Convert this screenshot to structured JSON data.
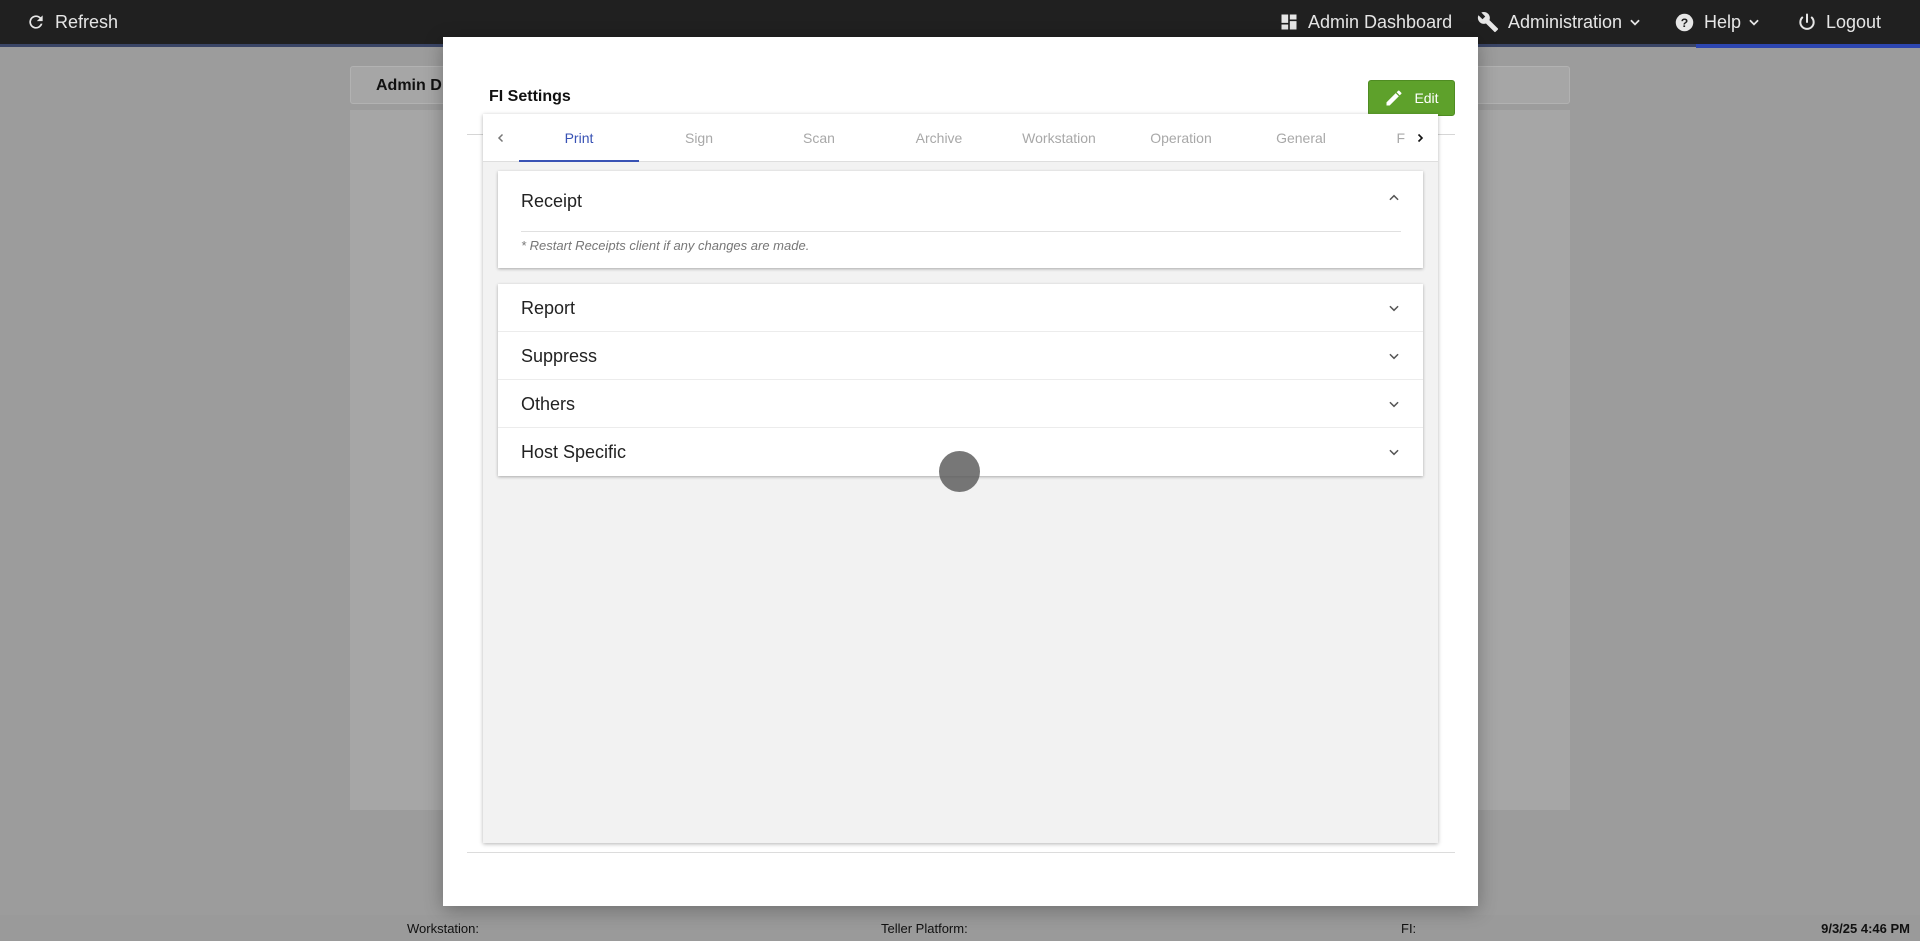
{
  "topbar": {
    "refresh_label": "Refresh",
    "admin_dashboard_label": "Admin Dashboard",
    "administration_label": "Administration",
    "help_label": "Help",
    "logout_label": "Logout"
  },
  "background": {
    "tab_label": "Admin D"
  },
  "status_bar": {
    "workstation_label": "Workstation:",
    "teller_platform_label": "Teller Platform:",
    "fi_label": "FI:",
    "datetime": "9/3/25 4:46 PM"
  },
  "modal": {
    "title": "FI Settings",
    "edit_label": "Edit",
    "tabs": [
      {
        "label": "Print",
        "active": true
      },
      {
        "label": "Sign",
        "active": false
      },
      {
        "label": "Scan",
        "active": false
      },
      {
        "label": "Archive",
        "active": false
      },
      {
        "label": "Workstation",
        "active": false
      },
      {
        "label": "Operation",
        "active": false
      },
      {
        "label": "General",
        "active": false
      },
      {
        "label": "F",
        "active": false
      }
    ],
    "expanded_panel": {
      "title": "Receipt",
      "note": "* Restart Receipts client if any changes are made."
    },
    "collapsed_panels": [
      {
        "title": "Report"
      },
      {
        "title": "Suppress"
      },
      {
        "title": "Others"
      },
      {
        "title": "Host Specific"
      }
    ]
  },
  "colors": {
    "topbar_bg": "#202020",
    "accent_blue": "#3852b4",
    "edit_green": "#5ea12b",
    "overlay_gray": "#9c9c9c"
  }
}
